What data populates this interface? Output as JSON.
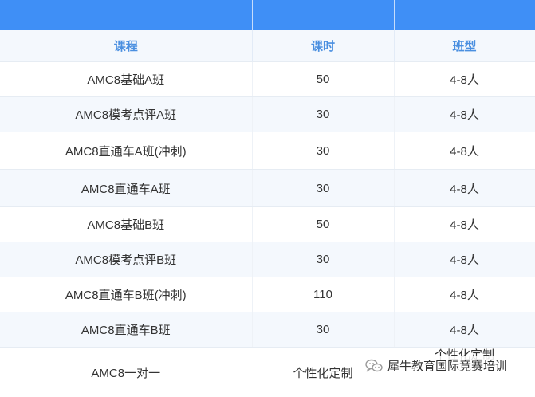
{
  "table": {
    "headers": [
      "课程",
      "课时",
      "班型"
    ],
    "rows": [
      {
        "course": "AMC8基础A班",
        "hours": "50",
        "class_type": "4-8人"
      },
      {
        "course": "AMC8模考点评A班",
        "hours": "30",
        "class_type": "4-8人"
      },
      {
        "course": "AMC8直通车A班(冲刺)",
        "hours": "30",
        "class_type": "4-8人"
      },
      {
        "course": "AMC8直通车A班",
        "hours": "30",
        "class_type": "4-8人"
      },
      {
        "course": "AMC8基础B班",
        "hours": "50",
        "class_type": "4-8人"
      },
      {
        "course": "AMC8模考点评B班",
        "hours": "30",
        "class_type": "4-8人"
      },
      {
        "course": "AMC8直通车B班(冲刺)",
        "hours": "110",
        "class_type": "4-8人"
      },
      {
        "course": "AMC8直通车B班",
        "hours": "30",
        "class_type": "4-8人"
      },
      {
        "course": "AMC8一对一",
        "hours": "个性化定制",
        "class_type": "个性化定制"
      }
    ]
  },
  "watermark": {
    "text": "犀牛教育国际竞赛培训",
    "icon": "wechat-icon"
  },
  "colors": {
    "top_band": "#3f8ff6",
    "header_text": "#4a8fe0",
    "stripe": "#f4f8fd"
  }
}
